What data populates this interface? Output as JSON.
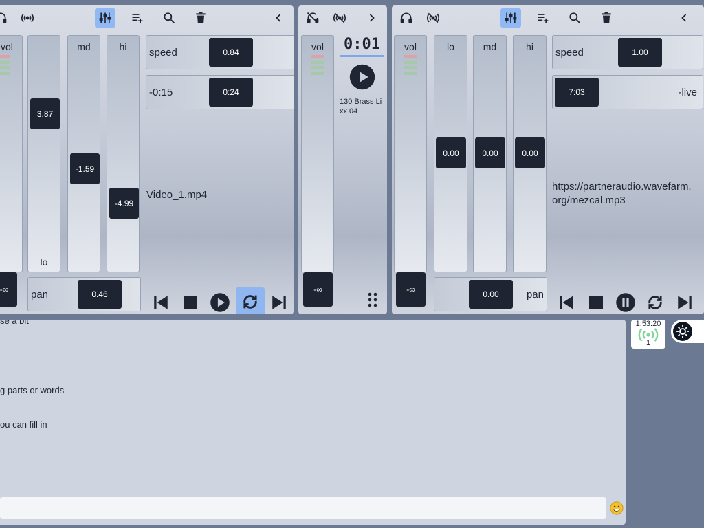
{
  "colors": {
    "accent": "#8fb6f1",
    "knob": "#1e2431",
    "meter_red": "#d9a3a8",
    "meter_green": "#a6c9a8",
    "progress": "#7ea6e8",
    "broadcast_green": "#7fd49a"
  },
  "deck_left": {
    "toolbar_icons": [
      "headphones-icon",
      "broadcast-icon",
      "mixer-icon",
      "add-to-playlist-icon",
      "search-icon",
      "trash-icon",
      "chevron-left-icon"
    ],
    "strips": {
      "vol": {
        "label": "vol",
        "value": "-∞"
      },
      "lo": {
        "label": "lo",
        "value": "3.87"
      },
      "md": {
        "label": "md",
        "value": "-1.59"
      },
      "hi": {
        "label": "hi",
        "value": "-4.99"
      }
    },
    "speed": {
      "label": "speed",
      "value": "0.84"
    },
    "position": {
      "remaining": "-0:15",
      "elapsed": "0:24"
    },
    "pan": {
      "label": "pan",
      "value": "0.46"
    },
    "track": "Video_1.mp4",
    "transport": [
      "skip-back-icon",
      "stop-icon",
      "play-icon",
      "loop-icon",
      "skip-forward-icon"
    ]
  },
  "deck_mid": {
    "toolbar_icons": [
      "headphones-off-icon",
      "broadcast-off-icon",
      "chevron-right-icon"
    ],
    "vol": {
      "label": "vol",
      "value": "-∞"
    },
    "time": "0:01",
    "track_line1": "130 Brass Li",
    "track_line2": "xx 04"
  },
  "deck_right": {
    "toolbar_icons": [
      "headphones-icon",
      "broadcast-off-icon",
      "mixer-icon",
      "add-to-playlist-icon",
      "search-icon",
      "trash-icon",
      "chevron-left-icon"
    ],
    "strips": {
      "vol": {
        "label": "vol",
        "value": "-∞"
      },
      "lo": {
        "label": "lo",
        "value": "0.00"
      },
      "md": {
        "label": "md",
        "value": "0.00"
      },
      "hi": {
        "label": "hi",
        "value": "0.00"
      }
    },
    "speed": {
      "label": "speed",
      "value": "1.00"
    },
    "position": {
      "elapsed": "7:03",
      "remaining": "-live"
    },
    "pan": {
      "label": "pan",
      "value": "0.00"
    },
    "track_line1": "https://partneraudio.wavefarm.",
    "track_line2": "org/mezcal.mp3",
    "transport": [
      "skip-back-icon",
      "stop-icon",
      "pause-icon",
      "loop-icon",
      "skip-forward-icon"
    ]
  },
  "chat": {
    "lines": [
      "se a bit",
      "g parts or words",
      "ou can fill in"
    ],
    "input_value": ""
  },
  "status": {
    "time": "1:53:20",
    "listeners": "1"
  }
}
